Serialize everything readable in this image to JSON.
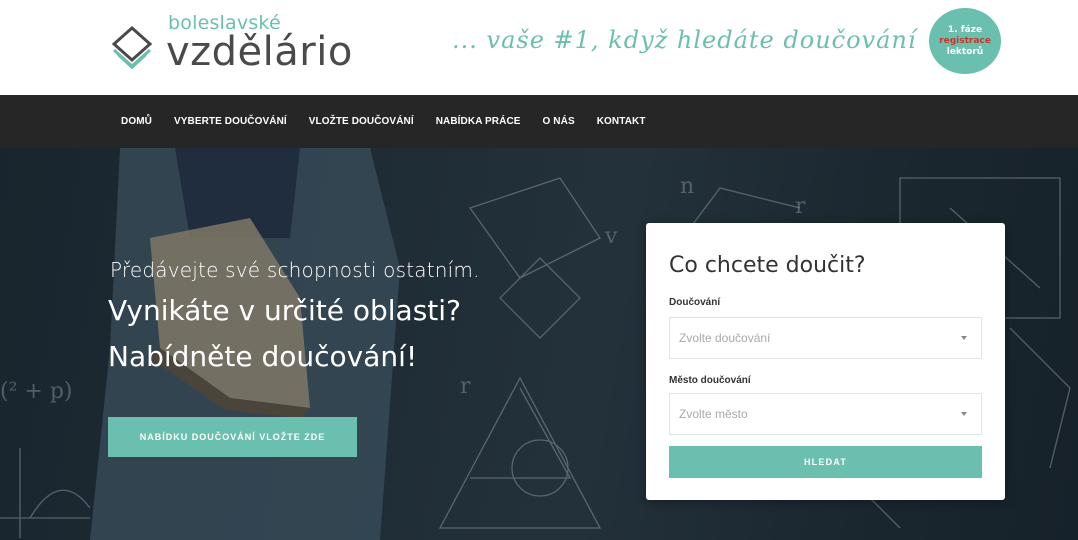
{
  "header": {
    "logo_small": "boleslavské",
    "logo_big": "vzdělário",
    "tagline": "... vaše #1, když hledáte doučování",
    "badge": {
      "line1": "1. fáze",
      "line2": "registrace",
      "line3": "lektorů"
    }
  },
  "nav": {
    "items": [
      {
        "label": "DOMŮ"
      },
      {
        "label": "VYBERTE DOUČOVÁNÍ"
      },
      {
        "label": "VLOŽTE DOUČOVÁNÍ"
      },
      {
        "label": "NABÍDKA PRÁCE"
      },
      {
        "label": "O NÁS"
      },
      {
        "label": "KONTAKT"
      }
    ]
  },
  "hero": {
    "line1": "Předávejte své schopnosti ostatním.",
    "line2": "Vynikáte v určité oblasti?",
    "line3": "Nabídněte doučování!",
    "cta": "NABÍDKU DOUČOVÁNÍ VLOŽTE ZDE"
  },
  "search": {
    "title": "Co chcete doučit?",
    "tutoring_label": "Doučování",
    "tutoring_placeholder": "Zvolte doučování",
    "city_label": "Město doučování",
    "city_placeholder": "Zvolte město",
    "button": "HLEDAT"
  },
  "colors": {
    "accent": "#6bbfae",
    "nav_bg": "#262626",
    "text_dark": "#333333"
  }
}
